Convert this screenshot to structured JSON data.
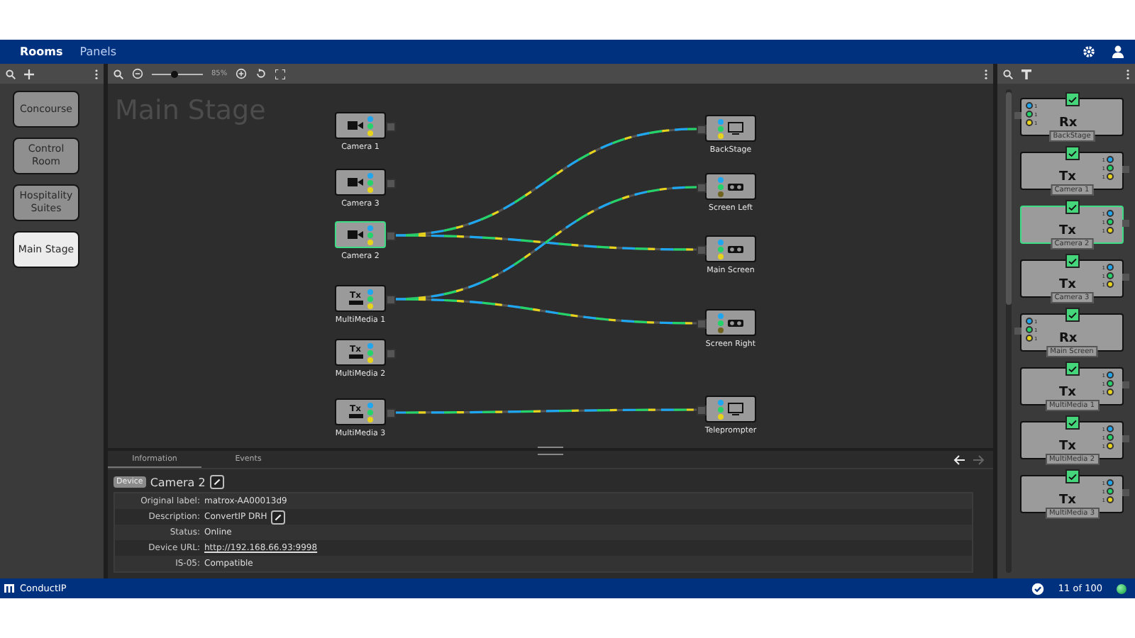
{
  "top_bar": {
    "tabs": [
      {
        "label": "Rooms",
        "selected": true
      },
      {
        "label": "Panels",
        "selected": false
      }
    ]
  },
  "rooms": [
    {
      "label": "Concourse",
      "selected": false
    },
    {
      "label": "Control Room",
      "selected": false
    },
    {
      "label": "Hospitality Suites",
      "selected": false
    },
    {
      "label": "Main Stage",
      "selected": true
    }
  ],
  "canvas": {
    "zoom": "85%",
    "level": 0.45,
    "title": "Main Stage",
    "sources": [
      {
        "label": "Camera 1",
        "kind": "camera",
        "selected": false,
        "signals": [
          true,
          true,
          true
        ]
      },
      {
        "label": "Camera 3",
        "kind": "camera",
        "selected": false,
        "signals": [
          true,
          true,
          true
        ]
      },
      {
        "label": "Camera 2",
        "kind": "camera",
        "selected": true,
        "signals": [
          true,
          true,
          true
        ]
      },
      {
        "label": "MultiMedia 1",
        "kind": "tx",
        "badge": "Tx",
        "selected": false,
        "signals": [
          true,
          true,
          true
        ]
      },
      {
        "label": "MultiMedia 2",
        "kind": "tx",
        "badge": "Tx",
        "selected": false,
        "signals": [
          true,
          true,
          true
        ]
      },
      {
        "label": "MultiMedia 3",
        "kind": "tx",
        "badge": "Tx",
        "selected": false,
        "signals": [
          true,
          true,
          true
        ]
      }
    ],
    "destinations": [
      {
        "label": "BackStage",
        "kind": "monitor",
        "signals": [
          true,
          true,
          true
        ]
      },
      {
        "label": "Screen Left",
        "kind": "projector",
        "signals": [
          true,
          true,
          false
        ]
      },
      {
        "label": "Main Screen",
        "kind": "projector",
        "signals": [
          true,
          true,
          true
        ]
      },
      {
        "label": "Screen Right",
        "kind": "projector",
        "signals": [
          true,
          true,
          false
        ]
      },
      {
        "label": "Teleprompter",
        "kind": "monitor",
        "signals": [
          true,
          true,
          true
        ]
      }
    ],
    "routes": [
      {
        "outputs": [
          false,
          false,
          false,
          false,
          false
        ]
      },
      {
        "outputs": [
          false,
          false,
          false,
          false,
          false
        ]
      },
      {
        "outputs": [
          true,
          false,
          true,
          false,
          false
        ]
      },
      {
        "outputs": [
          false,
          true,
          false,
          true,
          false
        ]
      },
      {
        "outputs": [
          false,
          false,
          false,
          false,
          false
        ]
      },
      {
        "outputs": [
          false,
          false,
          false,
          false,
          true
        ]
      }
    ]
  },
  "info": {
    "tabs": [
      {
        "label": "Information",
        "selected": true
      },
      {
        "label": "Events",
        "selected": false
      }
    ],
    "back_disabled": false,
    "forward_disabled": true,
    "tag": "Device",
    "name": "Camera 2",
    "rows": [
      {
        "label": "Original label:",
        "value": "matrox-AA00013d9",
        "kind": "text"
      },
      {
        "label": "Description:",
        "value": "ConvertIP DRH",
        "kind": "editable"
      },
      {
        "label": "Status:",
        "value": "Online",
        "kind": "text"
      },
      {
        "label": "Device URL:",
        "value": "http://192.168.66.93:9998",
        "kind": "link"
      },
      {
        "label": "IS-05:",
        "value": "Compatible",
        "kind": "text"
      }
    ]
  },
  "devices": [
    {
      "kind": "rx",
      "badge": "Rx",
      "label": "BackStage",
      "selected": false,
      "checked": true,
      "port_labels": [
        "1",
        "1",
        "1"
      ]
    },
    {
      "kind": "tx",
      "badge": "Tx",
      "label": "Camera 1",
      "selected": false,
      "checked": true,
      "port_labels": [
        "1",
        "1",
        "1"
      ]
    },
    {
      "kind": "tx",
      "badge": "Tx",
      "label": "Camera 2",
      "selected": true,
      "checked": true,
      "port_labels": [
        "1",
        "1",
        "1"
      ]
    },
    {
      "kind": "tx",
      "badge": "Tx",
      "label": "Camera 3",
      "selected": false,
      "checked": true,
      "port_labels": [
        "1",
        "1",
        "1"
      ]
    },
    {
      "kind": "rx",
      "badge": "Rx",
      "label": "Main Screen",
      "selected": false,
      "checked": true,
      "port_labels": [
        "1",
        "1",
        "1"
      ]
    },
    {
      "kind": "tx",
      "badge": "Tx",
      "label": "MultiMedia 1",
      "selected": false,
      "checked": true,
      "port_labels": [
        "1",
        "1",
        "1"
      ]
    },
    {
      "kind": "tx",
      "badge": "Tx",
      "label": "MultiMedia 2",
      "selected": false,
      "checked": true,
      "port_labels": [
        "1",
        "1",
        "1"
      ]
    },
    {
      "kind": "tx",
      "badge": "Tx",
      "label": "MultiMedia 3",
      "selected": false,
      "checked": true,
      "port_labels": [
        "1",
        "1",
        "1"
      ]
    }
  ],
  "status_bar": {
    "app": "ConductIP",
    "count": "11 of 100",
    "online": true
  }
}
